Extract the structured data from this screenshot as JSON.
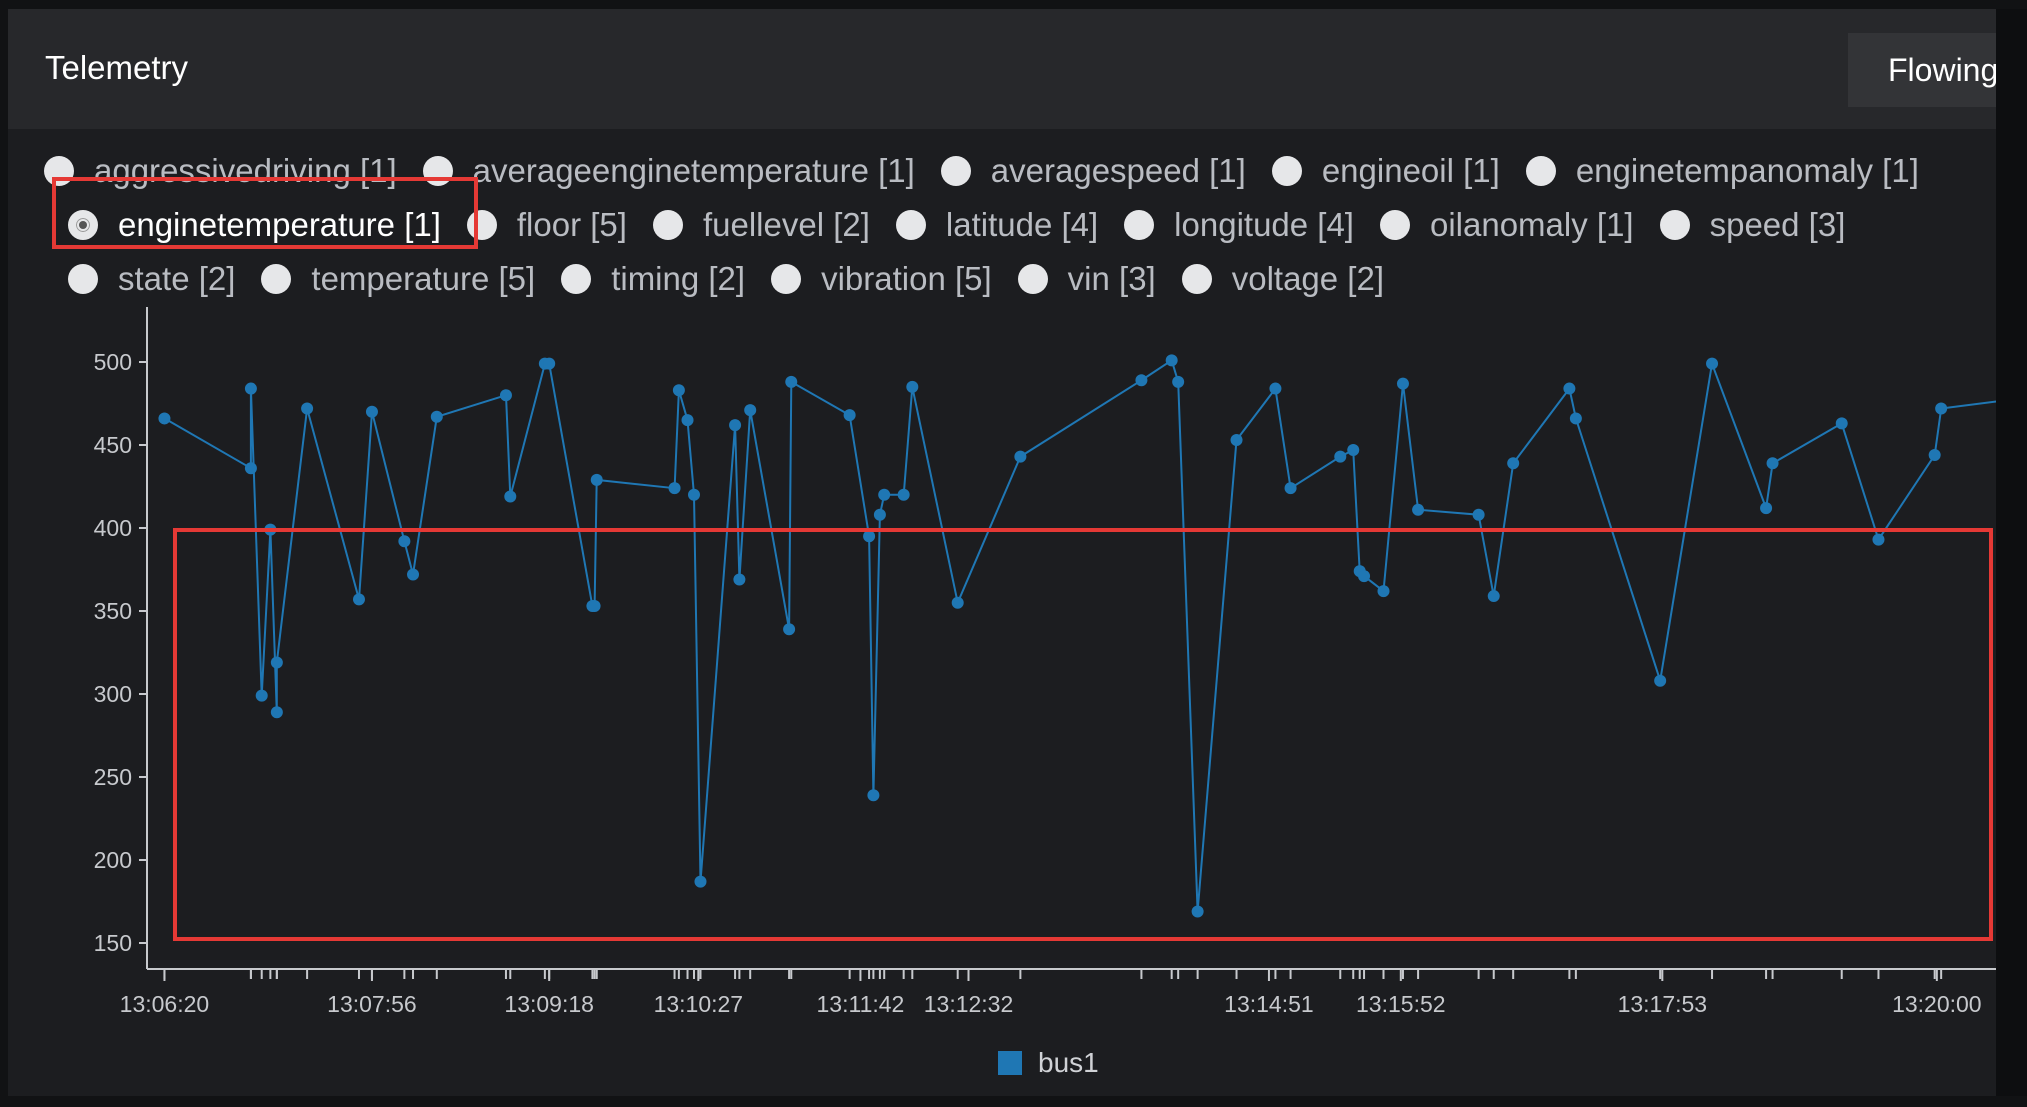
{
  "panel": {
    "title": "Telemetry",
    "flow_button": "Flowing"
  },
  "radios": [
    [
      {
        "label": "aggressivedriving [1]",
        "selected": false
      },
      {
        "label": "averageenginetemperature [1]",
        "selected": false
      },
      {
        "label": "averagespeed [1]",
        "selected": false
      },
      {
        "label": "engineoil [1]",
        "selected": false
      },
      {
        "label": "enginetempanomaly [1]",
        "selected": false
      }
    ],
    [
      {
        "label": "enginetemperature [1]",
        "selected": true
      },
      {
        "label": "floor [5]",
        "selected": false
      },
      {
        "label": "fuellevel [2]",
        "selected": false
      },
      {
        "label": "latitude [4]",
        "selected": false
      },
      {
        "label": "longitude [4]",
        "selected": false
      },
      {
        "label": "oilanomaly [1]",
        "selected": false
      },
      {
        "label": "speed [3]",
        "selected": false
      }
    ],
    [
      {
        "label": "state [2]",
        "selected": false
      },
      {
        "label": "temperature [5]",
        "selected": false
      },
      {
        "label": "timing [2]",
        "selected": false
      },
      {
        "label": "vibration [5]",
        "selected": false
      },
      {
        "label": "vin [3]",
        "selected": false
      },
      {
        "label": "voltage [2]",
        "selected": false
      }
    ]
  ],
  "colors": {
    "series": "#1f77b4",
    "highlight": "#e53935"
  },
  "chart_data": {
    "type": "line",
    "x_unit": "seconds since 13:06:20",
    "x_tick_labels": [
      "13:06:20",
      "13:07:56",
      "13:09:18",
      "13:10:27",
      "13:11:42",
      "13:12:32",
      "13:14:51",
      "13:15:52",
      "13:17:53",
      "13:20:00"
    ],
    "x_tick_values": [
      0,
      96,
      178,
      247,
      322,
      372,
      511,
      572,
      693,
      820
    ],
    "y_ticks": [
      150,
      200,
      250,
      300,
      350,
      400,
      450,
      500
    ],
    "ylim": [
      140,
      535
    ],
    "xlim": [
      -9,
      852
    ],
    "grid": false,
    "legend_position": "bottom-center",
    "series": [
      {
        "name": "bus1",
        "points": [
          [
            0,
            466
          ],
          [
            40,
            436
          ],
          [
            40,
            484
          ],
          [
            45,
            299
          ],
          [
            49,
            399
          ],
          [
            52,
            289
          ],
          [
            52,
            319
          ],
          [
            66,
            472
          ],
          [
            90,
            357
          ],
          [
            96,
            470
          ],
          [
            111,
            392
          ],
          [
            115,
            372
          ],
          [
            126,
            467
          ],
          [
            158,
            480
          ],
          [
            160,
            419
          ],
          [
            176,
            499
          ],
          [
            178,
            499
          ],
          [
            198,
            353
          ],
          [
            199,
            353
          ],
          [
            200,
            429
          ],
          [
            236,
            424
          ],
          [
            238,
            483
          ],
          [
            242,
            465
          ],
          [
            245,
            420
          ],
          [
            248,
            187
          ],
          [
            264,
            462
          ],
          [
            266,
            369
          ],
          [
            271,
            471
          ],
          [
            289,
            339
          ],
          [
            290,
            488
          ],
          [
            317,
            468
          ],
          [
            326,
            395
          ],
          [
            328,
            239
          ],
          [
            331,
            408
          ],
          [
            333,
            420
          ],
          [
            342,
            420
          ],
          [
            346,
            485
          ],
          [
            367,
            355
          ],
          [
            396,
            443
          ],
          [
            452,
            489
          ],
          [
            466,
            501
          ],
          [
            469,
            488
          ],
          [
            478,
            169
          ],
          [
            496,
            453
          ],
          [
            514,
            484
          ],
          [
            521,
            424
          ],
          [
            544,
            443
          ],
          [
            550,
            447
          ],
          [
            553,
            374
          ],
          [
            555,
            371
          ],
          [
            564,
            362
          ],
          [
            573,
            487
          ],
          [
            580,
            411
          ],
          [
            608,
            408
          ],
          [
            615,
            359
          ],
          [
            624,
            439
          ],
          [
            650,
            484
          ],
          [
            653,
            466
          ],
          [
            692,
            308
          ],
          [
            716,
            499
          ],
          [
            741,
            412
          ],
          [
            744,
            439
          ],
          [
            776,
            463
          ],
          [
            793,
            393
          ],
          [
            819,
            444
          ],
          [
            822,
            472
          ],
          [
            852,
            477
          ]
        ]
      }
    ]
  }
}
